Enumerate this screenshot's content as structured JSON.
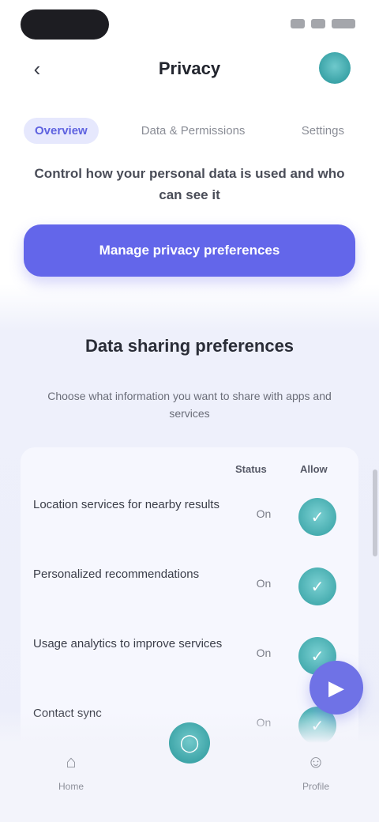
{
  "status_bar": {
    "time": "",
    "indicators": [
      "signal-icon",
      "wifi-icon",
      "battery-icon"
    ]
  },
  "header": {
    "title": "Privacy",
    "back_icon": "arrow-left-icon",
    "avatar_icon": "avatar"
  },
  "tabs": [
    {
      "label": "Overview",
      "active": true
    },
    {
      "label": "Data & Permissions",
      "active": false
    },
    {
      "label": "Settings",
      "active": false
    }
  ],
  "intro": {
    "subtitle": "Control how your personal data is used and who can see it"
  },
  "cta": {
    "label": "Manage privacy preferences"
  },
  "section": {
    "title": "Data sharing preferences",
    "description": "Choose what information you want to share with apps and services"
  },
  "table": {
    "columns": [
      "Status",
      "Allow"
    ],
    "rows": [
      {
        "label": "Location services for nearby results",
        "value": "On",
        "check_icon": "check-icon"
      },
      {
        "label": "Personalized recommendations",
        "value": "On",
        "check_icon": "check-icon"
      },
      {
        "label": "Usage analytics to improve services",
        "value": "On",
        "check_icon": "check-icon"
      },
      {
        "label": "Contact sync",
        "value": "On",
        "check_icon": "check-icon"
      }
    ]
  },
  "fab": {
    "icon": "chat-icon"
  },
  "bottom_nav": [
    {
      "label": "Home",
      "icon": "home-icon"
    },
    {
      "label": "",
      "icon": "shield-icon"
    },
    {
      "label": "Profile",
      "icon": "user-icon"
    }
  ],
  "colors": {
    "primary": "#6366ea",
    "accent": "#47adb0",
    "tab_active_bg": "#e6e8fd"
  }
}
